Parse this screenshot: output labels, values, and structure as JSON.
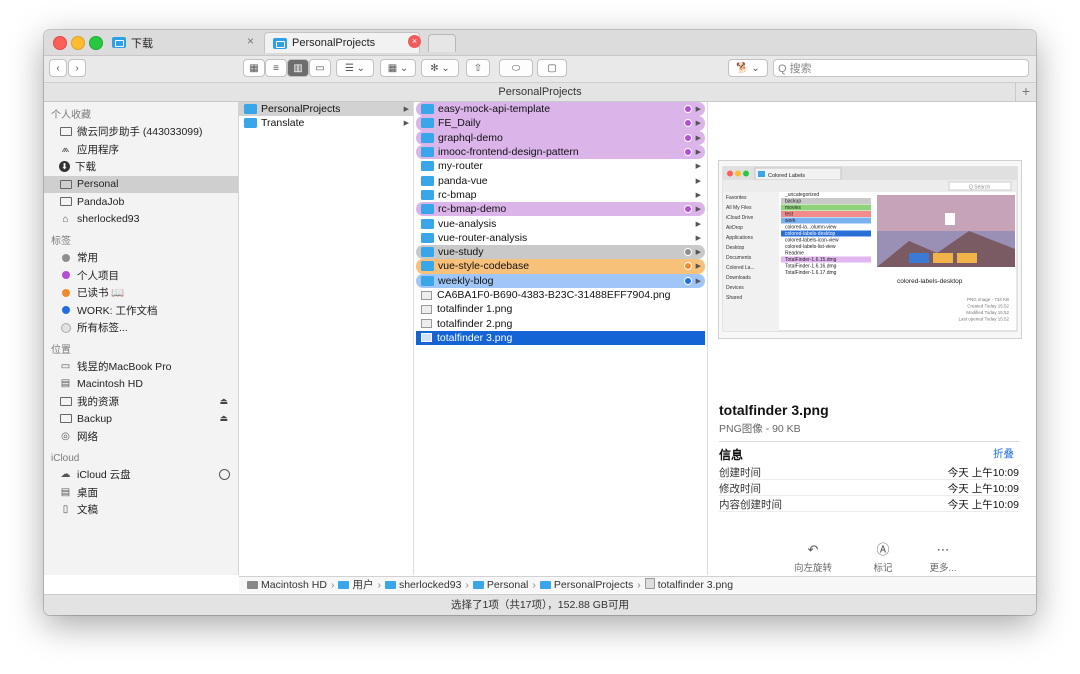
{
  "tabs": [
    {
      "label": "下载",
      "close": "×"
    },
    {
      "label": "PersonalProjects",
      "close": "×"
    }
  ],
  "search": {
    "placeholder": "Q 搜索"
  },
  "path_title": "PersonalProjects",
  "sidebar": {
    "sections": [
      {
        "title": "个人收藏",
        "items": [
          {
            "label": "微云同步助手 (443033099)",
            "icon": "folder-icon"
          },
          {
            "label": "应用程序",
            "icon": "applications-icon"
          },
          {
            "label": "下载",
            "icon": "download-icon"
          },
          {
            "label": "Personal",
            "icon": "folder-icon",
            "selected": true
          },
          {
            "label": "PandaJob",
            "icon": "folder-icon"
          },
          {
            "label": "sherlocked93",
            "icon": "home-icon"
          }
        ]
      },
      {
        "title": "标签",
        "items": [
          {
            "label": "常用",
            "color": "#8e8e8e"
          },
          {
            "label": "个人项目",
            "color": "#b34fd6"
          },
          {
            "label": "已读书 📖",
            "color": "#f08a2a"
          },
          {
            "label": "WORK: 工作文档",
            "color": "#1f6fe0"
          },
          {
            "label": "所有标签...",
            "color": "#e2e2e2"
          }
        ]
      },
      {
        "title": "位置",
        "items": [
          {
            "label": "钱昱的MacBook Pro",
            "icon": "laptop-icon"
          },
          {
            "label": "Macintosh HD",
            "icon": "disk-icon"
          },
          {
            "label": "我的资源",
            "icon": "folder-icon",
            "eject": true
          },
          {
            "label": "Backup",
            "icon": "folder-icon",
            "eject": true
          },
          {
            "label": "网络",
            "icon": "network-icon"
          }
        ]
      },
      {
        "title": "iCloud",
        "items": [
          {
            "label": "iCloud 云盘",
            "icon": "cloud-icon",
            "spinner": true
          },
          {
            "label": "桌面",
            "icon": "desktop-icon"
          },
          {
            "label": "文稿",
            "icon": "document-icon"
          }
        ]
      }
    ]
  },
  "column1": [
    {
      "label": "PersonalProjects",
      "selected": true
    },
    {
      "label": "Translate"
    }
  ],
  "column2": [
    {
      "label": "easy-mock-api-template",
      "type": "folder",
      "tag": "purple",
      "dot": "#b34fd6"
    },
    {
      "label": "FE_Daily",
      "type": "folder",
      "tag": "purple",
      "dot": "#b34fd6"
    },
    {
      "label": "graphql-demo",
      "type": "folder",
      "tag": "purple",
      "dot": "#b34fd6"
    },
    {
      "label": "imooc-frontend-design-pattern",
      "type": "folder",
      "tag": "purple",
      "dot": "#b34fd6"
    },
    {
      "label": "my-router",
      "type": "folder"
    },
    {
      "label": "panda-vue",
      "type": "folder"
    },
    {
      "label": "rc-bmap",
      "type": "folder"
    },
    {
      "label": "rc-bmap-demo",
      "type": "folder",
      "tag": "purple",
      "dot": "#b34fd6"
    },
    {
      "label": "vue-analysis",
      "type": "folder"
    },
    {
      "label": "vue-router-analysis",
      "type": "folder"
    },
    {
      "label": "vue-study",
      "type": "folder",
      "tag": "gray",
      "dot": "#8e8e8e"
    },
    {
      "label": "vue-style-codebase",
      "type": "folder",
      "tag": "orange",
      "dot": "#f08a2a"
    },
    {
      "label": "weekly-blog",
      "type": "folder",
      "tag": "blue",
      "dot": "#1f6fe0"
    },
    {
      "label": "CA6BA1F0-B690-4383-B23C-31488EFF7904.png",
      "type": "png"
    },
    {
      "label": "totalfinder 1.png",
      "type": "png"
    },
    {
      "label": "totalfinder 2.png",
      "type": "png"
    },
    {
      "label": "totalfinder 3.png",
      "type": "png",
      "selected": true
    }
  ],
  "preview": {
    "file_name": "totalfinder 3.png",
    "file_meta": "PNG图像 - 90 KB",
    "info_title": "信息",
    "info_toggle": "折叠",
    "info": [
      {
        "k": "创建时间",
        "v": "今天 上午10:09"
      },
      {
        "k": "修改时间",
        "v": "今天 上午10:09"
      },
      {
        "k": "内容创建时间",
        "v": "今天 上午10:09"
      }
    ],
    "actions": [
      {
        "label": "向左旋转",
        "icon": "rotate-left-icon"
      },
      {
        "label": "标记",
        "icon": "markup-icon"
      },
      {
        "label": "更多...",
        "icon": "more-icon"
      }
    ],
    "thumb": {
      "tab_label": "Colored Labels",
      "search": "Q Search",
      "sidebar": [
        "Favorites",
        "All My Files",
        "iCloud Drive",
        "AirDrop",
        "Applications",
        "Desktop",
        "Documents",
        "Colored La...",
        "Downloads",
        "Devices",
        "Shared"
      ],
      "files": [
        "_uncategorized",
        "backup",
        "movies",
        "test",
        "work",
        "colored-la...olumn-view",
        "colored-labels-desktop",
        "colored-labels-icon-view",
        "colored-labels-list-view",
        "Readme",
        "TotalFinder-1.6.15.dmg",
        "TotalFinder-1.6.16.dmg",
        "TotalFinder-1.6.17.dmg"
      ],
      "caption": "colored-labels-desktop",
      "meta": [
        "PNG image - 734 KB",
        "Created  Today 15:52",
        "Modified  Today 15:52",
        "Last opened  Today 15:52"
      ]
    }
  },
  "breadcrumb": [
    "Macintosh HD",
    "用户",
    "sherlocked93",
    "Personal",
    "PersonalProjects",
    "totalfinder 3.png"
  ],
  "status": "选择了1项（共17项），152.88 GB可用"
}
